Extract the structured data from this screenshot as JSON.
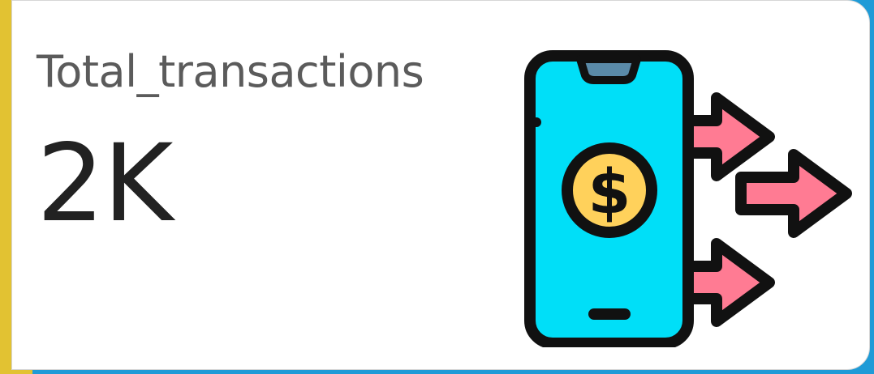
{
  "card": {
    "label": "Total_transactions",
    "value": "2K"
  },
  "illustration": {
    "icon": "phone-money-transfer-icon",
    "colors": {
      "phone": "#00dff8",
      "notch": "#5a8aa8",
      "coin": "#ffd15b",
      "arrows": "#ff7b93",
      "outline": "#111111"
    }
  },
  "theme": {
    "background": "#1f9bd7",
    "accent_strip": "#e2c232",
    "card_bg": "#ffffff"
  }
}
